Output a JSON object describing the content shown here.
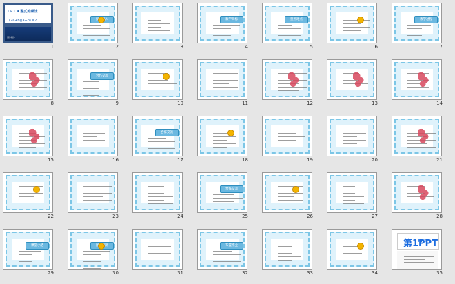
{
  "slides": [
    {
      "number": "1",
      "type": "title",
      "title": "15.1.4 整式的乘法",
      "formula": "(2a+b)(a+b) =?",
      "caption": "课件制作"
    },
    {
      "number": "2",
      "type": "blue",
      "label": "探究导入"
    },
    {
      "number": "3",
      "type": "blue",
      "label": ""
    },
    {
      "number": "4",
      "type": "blue",
      "label": "教学目标"
    },
    {
      "number": "5",
      "type": "blue",
      "label": "重点难点"
    },
    {
      "number": "6",
      "type": "blue",
      "label": ""
    },
    {
      "number": "7",
      "type": "blue",
      "label": "教学过程"
    },
    {
      "number": "8",
      "type": "flower",
      "label": ""
    },
    {
      "number": "9",
      "type": "blue",
      "label": "合作交流"
    },
    {
      "number": "10",
      "type": "blue",
      "label": ""
    },
    {
      "number": "11",
      "type": "blue",
      "label": ""
    },
    {
      "number": "12",
      "type": "flower",
      "label": ""
    },
    {
      "number": "13",
      "type": "flower",
      "label": ""
    },
    {
      "number": "14",
      "type": "flower",
      "label": ""
    },
    {
      "number": "15",
      "type": "flower",
      "label": ""
    },
    {
      "number": "16",
      "type": "blue",
      "label": ""
    },
    {
      "number": "17",
      "type": "blue",
      "label": "合作交流"
    },
    {
      "number": "18",
      "type": "blue",
      "label": ""
    },
    {
      "number": "19",
      "type": "blue",
      "label": ""
    },
    {
      "number": "20",
      "type": "blue",
      "label": ""
    },
    {
      "number": "21",
      "type": "flower",
      "label": ""
    },
    {
      "number": "22",
      "type": "blue",
      "label": ""
    },
    {
      "number": "23",
      "type": "blue",
      "label": ""
    },
    {
      "number": "24",
      "type": "blue",
      "label": ""
    },
    {
      "number": "25",
      "type": "blue",
      "label": "合作交流"
    },
    {
      "number": "26",
      "type": "blue",
      "label": ""
    },
    {
      "number": "27",
      "type": "blue",
      "label": ""
    },
    {
      "number": "28",
      "type": "flower",
      "label": ""
    },
    {
      "number": "29",
      "type": "blue",
      "label": "课堂小结"
    },
    {
      "number": "30",
      "type": "blue",
      "label": "随堂检测"
    },
    {
      "number": "31",
      "type": "blue",
      "label": ""
    },
    {
      "number": "32",
      "type": "blue",
      "label": "布置作业"
    },
    {
      "number": "33",
      "type": "blue",
      "label": ""
    },
    {
      "number": "34",
      "type": "blue",
      "label": ""
    },
    {
      "number": "35",
      "type": "logo",
      "logo_main": "第1PPT",
      "logo_sub": "PPT"
    }
  ],
  "colors": {
    "frame": "#7cc6e6",
    "title": "#6bb8e0",
    "badge": "#e46a6a",
    "accent": "#1c6de0"
  }
}
